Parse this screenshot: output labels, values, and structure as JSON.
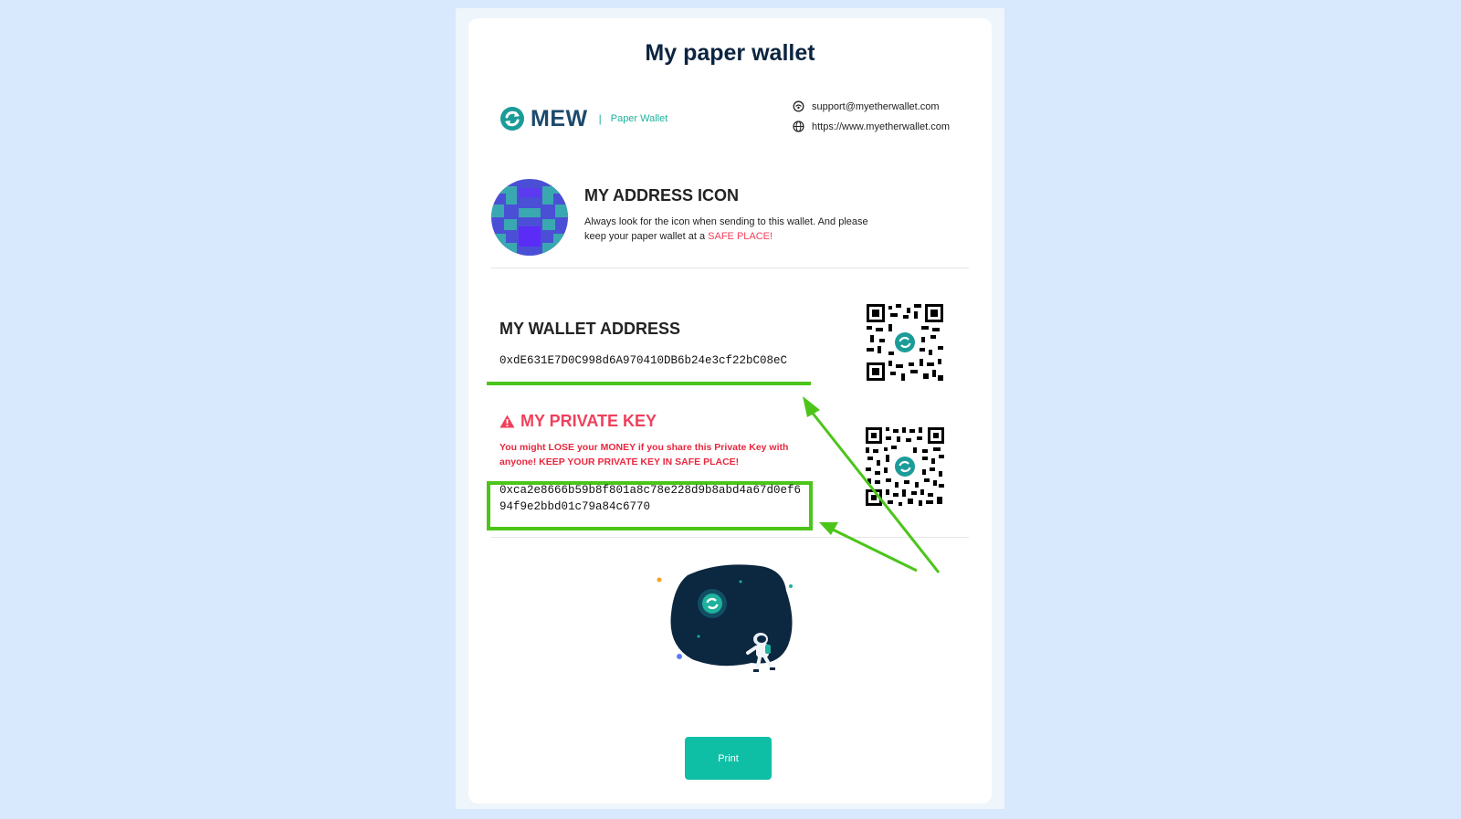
{
  "page": {
    "title": "My paper wallet"
  },
  "brand": {
    "logo_text": "MEW",
    "separator": "|",
    "subtitle": "Paper Wallet"
  },
  "contact": {
    "email": "support@myetherwallet.com",
    "website": "https://www.myetherwallet.com"
  },
  "address_icon": {
    "heading": "MY ADDRESS ICON",
    "description": "Always look for the icon when sending to this wallet. And please keep your paper wallet at a",
    "safe_place": "SAFE PLACE!"
  },
  "wallet_address": {
    "heading": "MY WALLET ADDRESS",
    "value": "0xdE631E7D0C998d6A970410DB6b24e3cf22bC08eC"
  },
  "private_key": {
    "heading": "MY PRIVATE KEY",
    "warning": "You might LOSE your MONEY if you share this Private Key with anyone! KEEP YOUR PRIVATE KEY IN SAFE PLACE!",
    "line1": "0xca2e8666b59b8f801a8c78e228d9b8abd4a67d0ef6",
    "line2": "94f9e2bbd01c79a84c6770"
  },
  "actions": {
    "print_label": "Print"
  },
  "colors": {
    "accent": "#0fbfa5",
    "danger": "#f0405c",
    "highlight": "#4cc51a",
    "heading": "#0b2440"
  }
}
